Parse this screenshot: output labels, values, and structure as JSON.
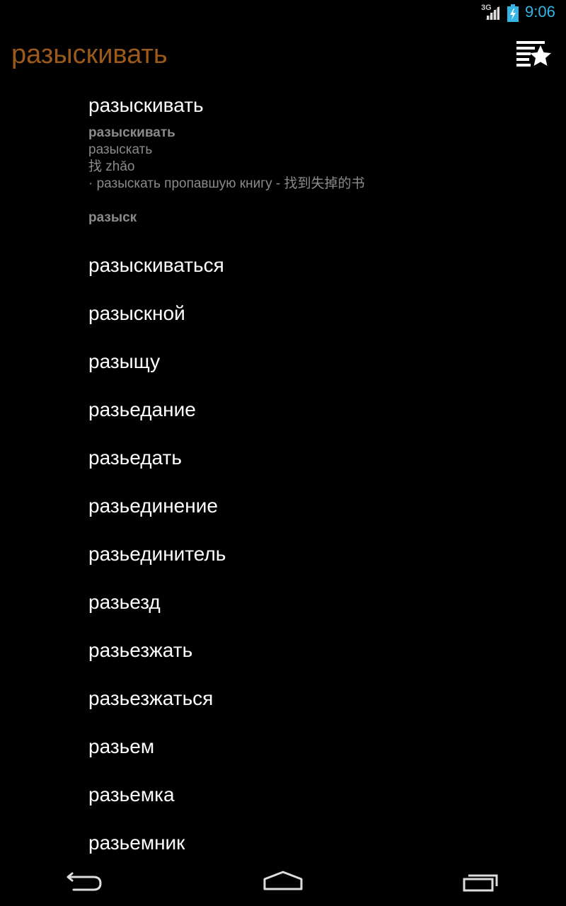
{
  "status_bar": {
    "network": "3G",
    "clock": "9:06"
  },
  "action_bar": {
    "title": "разыскивать",
    "favorites_icon": "star-list-icon"
  },
  "expanded_entry": {
    "headword": "разыскивать",
    "lemma": "разыскивать",
    "perfective": "разыскать",
    "translation": "找 zhǎo",
    "example": "· разыскать пропавшую книгу - 找到失掉的书",
    "related": "разыск"
  },
  "words": [
    "разыскиваться",
    "разыскной",
    "разыщу",
    "разьедание",
    "разьедать",
    "разьединение",
    "разьединитель",
    "разьезд",
    "разьезжать",
    "разьезжаться",
    "разьем",
    "разьемка",
    "разьемник"
  ],
  "colors": {
    "title": "#9b5a1a",
    "clock": "#33b5e5",
    "detail_text": "#8a8a8a"
  },
  "nav": {
    "back_icon": "back-icon",
    "home_icon": "home-icon",
    "recents_icon": "recents-icon"
  }
}
